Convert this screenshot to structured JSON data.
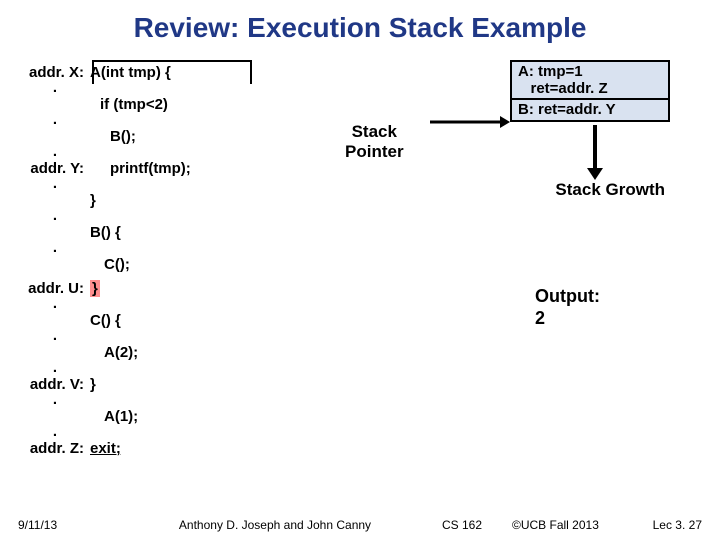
{
  "title": "Review: Execution Stack Example",
  "code": {
    "addrX": "addr. X:",
    "A_sig": "A(int tmp) {",
    "if": "if (tmp<2)",
    "Bcall": "B();",
    "addrY": "addr. Y:",
    "printf": "printf(tmp);",
    "closeA": "}",
    "B_sig": "B() {",
    "Ccall": "C();",
    "addrU": "addr. U:",
    "closeB": "}",
    "C_sig": "C() {",
    "Acall2": "A(2);",
    "addrV": "addr. V:",
    "closeC": "}",
    "Acall1": "A(1);",
    "addrZ": "addr. Z:",
    "exit": "exit;"
  },
  "stack": {
    "pointer": "Stack\nPointer",
    "frameA": "A: tmp=1\n   ret=addr. Z",
    "frameB": "B: ret=addr. Y",
    "growth": "Stack Growth"
  },
  "output": {
    "label": "Output:",
    "value": "2"
  },
  "footer": {
    "date": "9/11/13",
    "authors": "Anthony D. Joseph and John Canny",
    "course": "CS 162",
    "copy": "©UCB Fall 2013",
    "lec": "Lec 3. 27"
  }
}
